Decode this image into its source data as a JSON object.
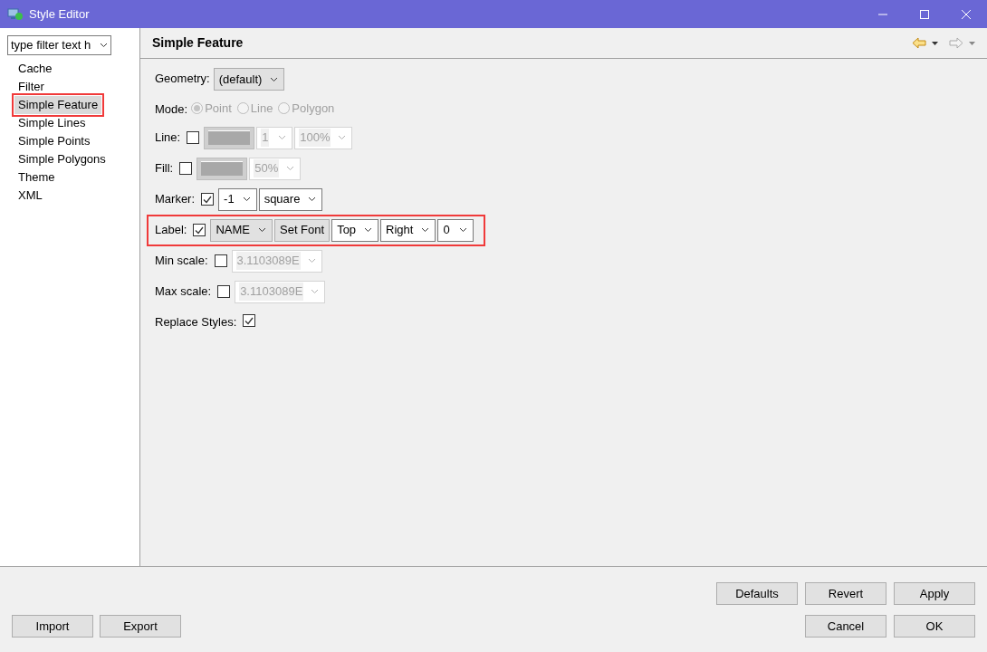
{
  "window": {
    "title": "Style Editor"
  },
  "filter": {
    "value": "type filter text h"
  },
  "sidebar": {
    "items": [
      {
        "label": "Cache",
        "selected": false,
        "highlighted": false
      },
      {
        "label": "Filter",
        "selected": false,
        "highlighted": false
      },
      {
        "label": "Simple Feature",
        "selected": true,
        "highlighted": true
      },
      {
        "label": "Simple Lines",
        "selected": false,
        "highlighted": false
      },
      {
        "label": "Simple Points",
        "selected": false,
        "highlighted": false
      },
      {
        "label": "Simple Polygons",
        "selected": false,
        "highlighted": false
      },
      {
        "label": "Theme",
        "selected": false,
        "highlighted": false
      },
      {
        "label": "XML",
        "selected": false,
        "highlighted": false
      }
    ]
  },
  "page": {
    "title": "Simple Feature"
  },
  "rows": [
    {
      "label": "Geometry:",
      "highlighted": false,
      "controls": [
        {
          "kind": "combo",
          "value": "(default)",
          "disabled": false
        }
      ]
    },
    {
      "label": "Mode:",
      "highlighted": false,
      "controls": [
        {
          "kind": "radio",
          "label": "Point",
          "selected": true,
          "disabled": true
        },
        {
          "kind": "radio",
          "label": "Line",
          "selected": false,
          "disabled": true
        },
        {
          "kind": "radio",
          "label": "Polygon",
          "selected": false,
          "disabled": true
        }
      ]
    },
    {
      "label": "Line:",
      "highlighted": false,
      "controls": [
        {
          "kind": "checkbox",
          "checked": false
        },
        {
          "kind": "swatch",
          "disabled": true
        },
        {
          "kind": "dropdown",
          "value": "1",
          "disabled": true
        },
        {
          "kind": "dropdown",
          "value": "100%",
          "disabled": true
        }
      ]
    },
    {
      "label": "Fill:",
      "highlighted": false,
      "controls": [
        {
          "kind": "checkbox",
          "checked": false
        },
        {
          "kind": "swatch",
          "disabled": true
        },
        {
          "kind": "dropdown",
          "value": "50%",
          "disabled": true
        }
      ]
    },
    {
      "label": "Marker:",
      "highlighted": false,
      "controls": [
        {
          "kind": "checkbox",
          "checked": true
        },
        {
          "kind": "dropdown",
          "value": "-1",
          "disabled": false
        },
        {
          "kind": "dropdown",
          "value": "square",
          "disabled": false
        }
      ]
    },
    {
      "label": "Label:",
      "highlighted": true,
      "controls": [
        {
          "kind": "checkbox",
          "checked": true
        },
        {
          "kind": "combo",
          "value": "NAME",
          "disabled": false
        },
        {
          "kind": "button",
          "label": "Set Font"
        },
        {
          "kind": "dropdown",
          "value": "Top",
          "disabled": false
        },
        {
          "kind": "dropdown",
          "value": "Right",
          "disabled": false
        },
        {
          "kind": "dropdown",
          "value": "0",
          "disabled": false
        }
      ]
    },
    {
      "label": "Min scale:",
      "highlighted": false,
      "controls": [
        {
          "kind": "checkbox",
          "checked": false
        },
        {
          "kind": "dropdown",
          "value": "3.1103089E",
          "disabled": true
        }
      ]
    },
    {
      "label": "Max scale:",
      "highlighted": false,
      "controls": [
        {
          "kind": "checkbox",
          "checked": false
        },
        {
          "kind": "dropdown",
          "value": "3.1103089E",
          "disabled": true
        }
      ]
    },
    {
      "label": "Replace Styles:",
      "highlighted": false,
      "controls": [
        {
          "kind": "checkbox",
          "checked": true
        }
      ]
    }
  ],
  "buttons_left": [
    "Import",
    "Export"
  ],
  "buttons_right_top": [
    "Defaults",
    "Revert",
    "Apply"
  ],
  "buttons_right_bottom": [
    "Cancel",
    "OK"
  ]
}
